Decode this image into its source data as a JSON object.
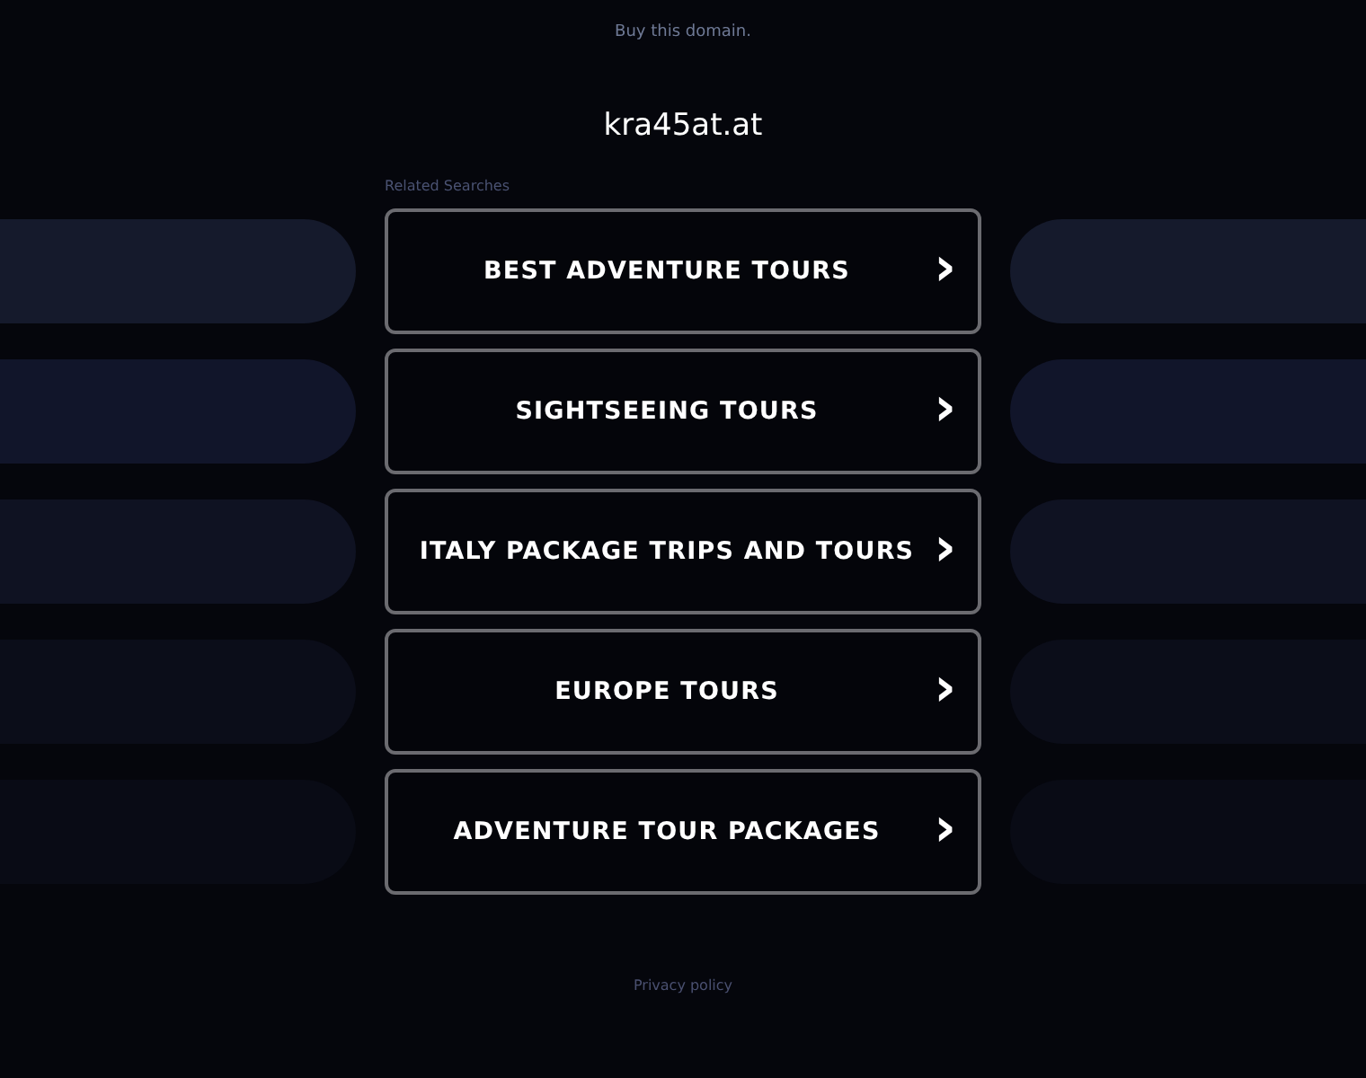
{
  "top_link": "Buy this domain.",
  "domain_title": "kra45at.at",
  "related_heading": "Related Searches",
  "links": [
    {
      "label": "BEST ADVENTURE TOURS",
      "arrow": "›"
    },
    {
      "label": "SIGHTSEEING TOURS",
      "arrow": "›"
    },
    {
      "label": "ITALY PACKAGE TRIPS AND TOURS",
      "arrow": "›"
    },
    {
      "label": "EUROPE TOURS",
      "arrow": "›"
    },
    {
      "label": "ADVENTURE TOUR PACKAGES",
      "arrow": "›"
    }
  ],
  "footer_link": "Privacy policy"
}
